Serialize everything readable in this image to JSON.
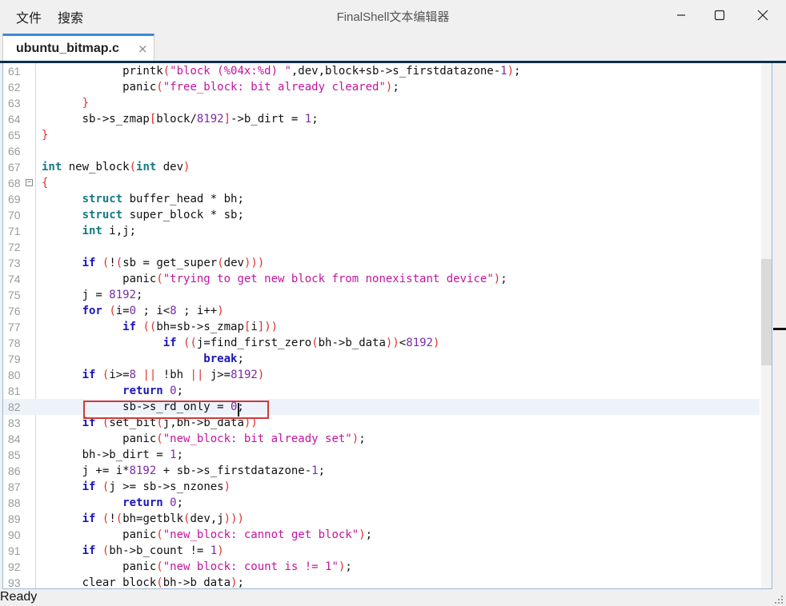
{
  "window": {
    "title": "FinalShell文本编辑器",
    "menu": [
      {
        "label": "文件"
      },
      {
        "label": "搜索"
      }
    ],
    "controls": {
      "minimize": "minimize-icon",
      "maximize": "maximize-icon",
      "close": "close-icon"
    }
  },
  "tabs": [
    {
      "label": "ubuntu_bitmap.c",
      "close": "×",
      "active": true
    }
  ],
  "editor": {
    "current_line": 82,
    "folded_marker_line": 68,
    "lines": [
      {
        "n": "61",
        "code": "            printk(\"block (%04x:%d) \",dev,block+sb->s_firstdatazone-1);"
      },
      {
        "n": "62",
        "code": "            panic(\"free_block: bit already cleared\");"
      },
      {
        "n": "63",
        "code": "      }"
      },
      {
        "n": "64",
        "code": "      sb->s_zmap[block/8192]->b_dirt = 1;"
      },
      {
        "n": "65",
        "code": "}"
      },
      {
        "n": "66",
        "code": ""
      },
      {
        "n": "67",
        "code": "int new_block(int dev)"
      },
      {
        "n": "68",
        "code": "{"
      },
      {
        "n": "69",
        "code": "      struct buffer_head * bh;"
      },
      {
        "n": "70",
        "code": "      struct super_block * sb;"
      },
      {
        "n": "71",
        "code": "      int i,j;"
      },
      {
        "n": "72",
        "code": ""
      },
      {
        "n": "73",
        "code": "      if (!(sb = get_super(dev)))"
      },
      {
        "n": "74",
        "code": "            panic(\"trying to get new block from nonexistant device\");"
      },
      {
        "n": "75",
        "code": "      j = 8192;"
      },
      {
        "n": "76",
        "code": "      for (i=0 ; i<8 ; i++)"
      },
      {
        "n": "77",
        "code": "            if ((bh=sb->s_zmap[i]))"
      },
      {
        "n": "78",
        "code": "                  if ((j=find_first_zero(bh->b_data))<8192)"
      },
      {
        "n": "79",
        "code": "                        break;"
      },
      {
        "n": "80",
        "code": "      if (i>=8 || !bh || j>=8192)"
      },
      {
        "n": "81",
        "code": "            return 0;"
      },
      {
        "n": "82",
        "code": "            sb->s_rd_only = 0;"
      },
      {
        "n": "83",
        "code": "      if (set_bit(j,bh->b_data))"
      },
      {
        "n": "84",
        "code": "            panic(\"new_block: bit already set\");"
      },
      {
        "n": "85",
        "code": "      bh->b_dirt = 1;"
      },
      {
        "n": "86",
        "code": "      j += i*8192 + sb->s_firstdatazone-1;"
      },
      {
        "n": "87",
        "code": "      if (j >= sb->s_nzones)"
      },
      {
        "n": "88",
        "code": "            return 0;"
      },
      {
        "n": "89",
        "code": "      if (!(bh=getblk(dev,j)))"
      },
      {
        "n": "90",
        "code": "            panic(\"new_block: cannot get block\");"
      },
      {
        "n": "91",
        "code": "      if (bh->b_count != 1)"
      },
      {
        "n": "92",
        "code": "            panic(\"new block: count is != 1\");"
      },
      {
        "n": "93",
        "code": "      clear_block(bh->b_data);"
      }
    ]
  },
  "status": {
    "text": "Ready"
  },
  "colors": {
    "accent": "#3b8ad9",
    "highlight_box": "#d03a3a",
    "keyword": "#1b17b8",
    "string": "#c3149f",
    "number": "#7a2aa8"
  }
}
